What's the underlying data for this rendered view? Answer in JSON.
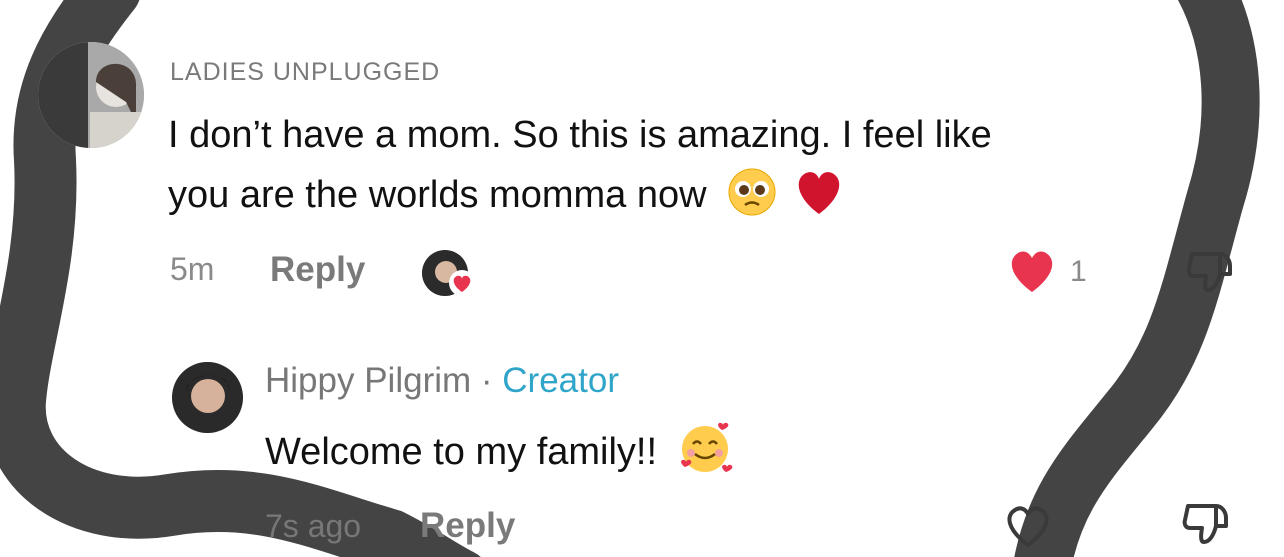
{
  "comment": {
    "username": "LADIES UNPLUGGED",
    "text_line1": "I don’t have a mom. So this is amazing. I feel like",
    "text_line2": "you are the worlds momma now",
    "emoji_pleading": "pleading-face-emoji",
    "emoji_heart": "red-heart-emoji",
    "time": "5m",
    "reply_label": "Reply",
    "like_count": "1",
    "liked": true,
    "like_color": "#e8344e"
  },
  "reply": {
    "username": "Hippy Pilgrim",
    "separator": "·",
    "badge": "Creator",
    "badge_color": "#2fa5c9",
    "text": "Welcome to my family!!",
    "emoji": "smiling-face-with-hearts-emoji",
    "time": "7s ago",
    "reply_label": "Reply",
    "liked": false
  }
}
